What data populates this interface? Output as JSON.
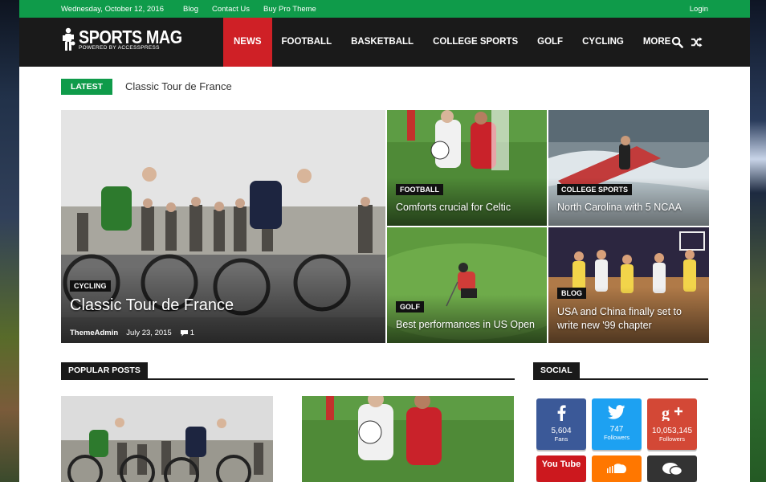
{
  "topbar": {
    "date": "Wednesday, October 12, 2016",
    "links": [
      "Blog",
      "Contact Us",
      "Buy Pro Theme"
    ],
    "login": "Login"
  },
  "header": {
    "logo_title": "SPORTS MAG",
    "logo_subtitle": "POWERED BY ACCESSPRESS",
    "nav": [
      "NEWS",
      "FOOTBALL",
      "BASKETBALL",
      "COLLEGE SPORTS",
      "GOLF",
      "CYCLING",
      "MORE"
    ],
    "active_nav": "NEWS"
  },
  "ticker": {
    "label": "LATEST",
    "title": "Classic Tour de France"
  },
  "featured": {
    "main": {
      "category": "CYCLING",
      "title": "Classic Tour de France",
      "author": "ThemeAdmin",
      "date": "July 23, 2015",
      "comments": "1"
    },
    "tiles": [
      {
        "category": "FOOTBALL",
        "title": "Comforts crucial for Celtic"
      },
      {
        "category": "COLLEGE SPORTS",
        "title": "North Carolina with 5 NCAA"
      },
      {
        "category": "GOLF",
        "title": "Best performances in US Open"
      },
      {
        "category": "BLOG",
        "title": "USA and China finally set to",
        "title2": "write new '99 chapter"
      }
    ]
  },
  "popular": {
    "heading": "POPULAR POSTS"
  },
  "social": {
    "heading": "SOCIAL",
    "items": [
      {
        "network": "facebook",
        "count": "5,604",
        "label": "Fans",
        "color": "#3b5998"
      },
      {
        "network": "twitter",
        "count": "747",
        "label": "Followers",
        "color": "#1da1f2"
      },
      {
        "network": "google-plus",
        "count": "10,053,145",
        "label": "Followers",
        "color": "#d34836"
      },
      {
        "network": "youtube",
        "label": "You Tube",
        "color": "#cc181e"
      },
      {
        "network": "soundcloud",
        "color": "#ff7700"
      },
      {
        "network": "comments",
        "color": "#333333"
      }
    ]
  },
  "colors": {
    "accent_green": "#0f9b4a",
    "accent_red": "#cf2026",
    "header_dark": "#1a1a1a"
  }
}
